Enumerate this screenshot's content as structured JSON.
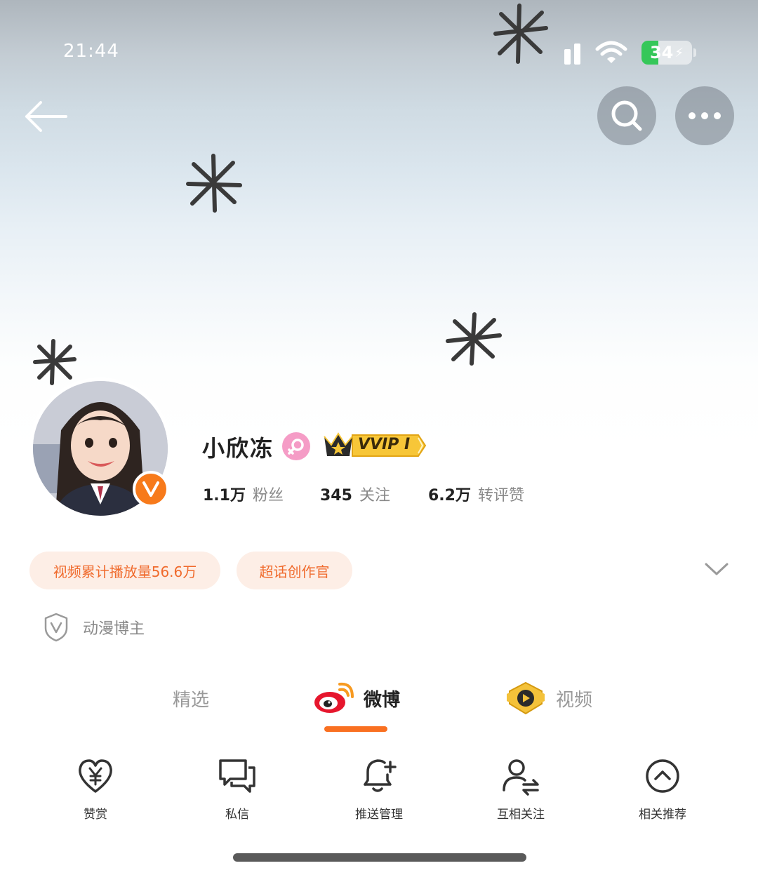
{
  "status_bar": {
    "time": "21:44",
    "battery_level": "34",
    "icons": [
      "cellular-signal-icon",
      "wifi-icon",
      "battery-charging-icon"
    ]
  },
  "nav": {
    "back_icon": "arrow-left-icon",
    "search_icon": "search-icon",
    "more_icon": "more-dots-icon"
  },
  "profile": {
    "username": "小欣冻",
    "gender_icon": "female-icon",
    "vip_badge": "VVIP I",
    "verified_icon": "verified-v-icon",
    "verified_color": "#f77a1b",
    "stats": [
      {
        "value": "1.1万",
        "label": "粉丝"
      },
      {
        "value": "345",
        "label": "关注"
      },
      {
        "value": "6.2万",
        "label": "转评赞"
      }
    ],
    "tags": [
      "视频累计播放量56.6万",
      "超话创作官"
    ],
    "certification": "动漫博主"
  },
  "tabs": [
    {
      "label": "精选",
      "active": false
    },
    {
      "label": "微博",
      "active": true,
      "icon": "weibo-logo-icon"
    },
    {
      "label": "视频",
      "active": false,
      "icon": "video-badge-icon"
    }
  ],
  "accent_color": "#f97021",
  "actions": [
    {
      "label": "赞赏",
      "icon": "heart-yen-icon"
    },
    {
      "label": "私信",
      "icon": "message-bubbles-icon"
    },
    {
      "label": "推送管理",
      "icon": "bell-plus-icon"
    },
    {
      "label": "互相关注",
      "icon": "user-exchange-icon"
    },
    {
      "label": "相关推荐",
      "icon": "chevron-up-circle-icon"
    }
  ]
}
